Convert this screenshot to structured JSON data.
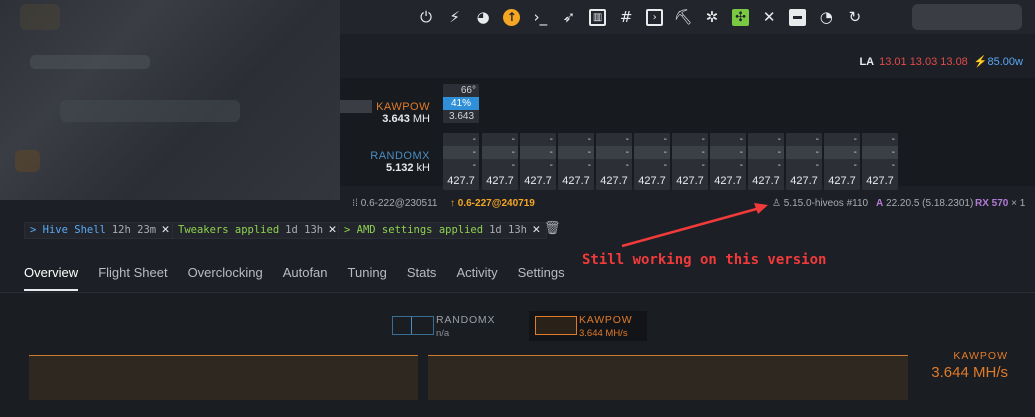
{
  "toolbar": {
    "icons": [
      "power-icon",
      "flash-icon",
      "globe-icon",
      "upgrade-icon",
      "terminal-icon",
      "rocket-icon",
      "gauge-icon",
      "hash-icon",
      "console-icon",
      "pickaxe-icon",
      "bug-icon",
      "fan-icon",
      "tools-icon",
      "minus-square-icon",
      "stopwatch-icon",
      "reload-icon"
    ]
  },
  "load": {
    "label": "LA",
    "values": "13.01 13.03 13.08",
    "power": "85.00",
    "power_unit": "w"
  },
  "algos": {
    "kawpow": {
      "name": "KAWPOW",
      "rate": "3.643",
      "unit": "MH"
    },
    "randomx": {
      "name": "RANDOMX",
      "rate": "5.132",
      "unit": "kH"
    }
  },
  "gpu": {
    "temp": "66°",
    "fan": "41%",
    "hash": "3.643"
  },
  "cpu_cards": {
    "dash": "-",
    "value": "427.7"
  },
  "versions": {
    "current": "0.6-222@230511",
    "update": "0.6-227@240719",
    "kernel": "5.15.0-hiveos #110",
    "amd_prefix": "A",
    "amd": "22.20.5 (5.18.2301)",
    "gpu_model": "RX 570",
    "gpu_count": "× 1"
  },
  "tags": [
    {
      "text": "> Hive Shell",
      "time": "12h 23m"
    },
    {
      "text": "Tweakers applied",
      "time": "1d 13h"
    },
    {
      "text": "> AMD settings applied",
      "time": "1d 13h"
    }
  ],
  "annotation": "Still working on this version",
  "tabs": [
    "Overview",
    "Flight Sheet",
    "Overclocking",
    "Autofan",
    "Tuning",
    "Stats",
    "Activity",
    "Settings"
  ],
  "selectors": {
    "randomx": {
      "name": "RANDOMX",
      "sub": "n/a"
    },
    "kawpow": {
      "name": "KAWPOW",
      "sub": "3.644 MH/s"
    }
  },
  "chart_legend": {
    "name": "KAWPOW",
    "value": "3.644 MH/s"
  },
  "colors": {
    "accent": "#f5a623",
    "kawpow": "#e07b2a",
    "randomx": "#4c8cbf",
    "annotation": "#f23a3a"
  }
}
